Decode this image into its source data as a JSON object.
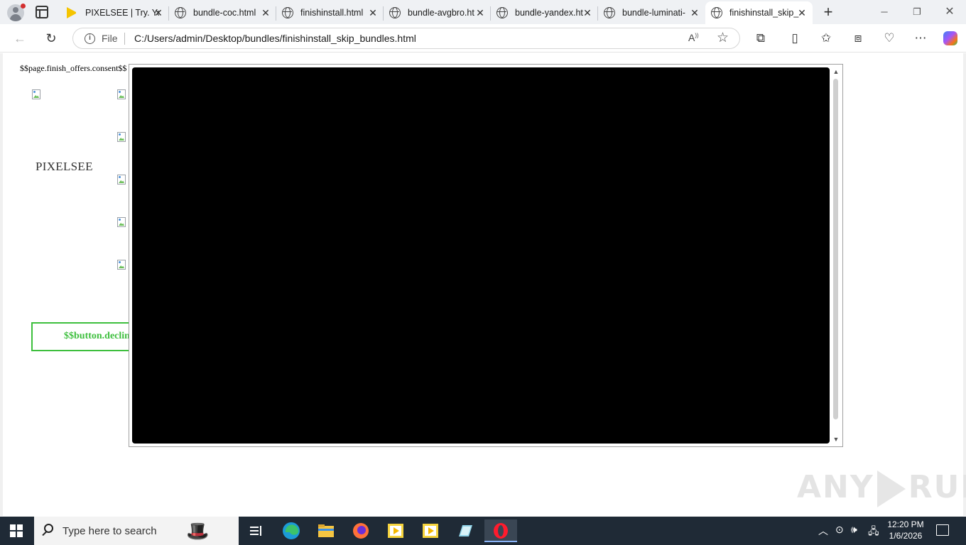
{
  "browser": {
    "tabs": [
      {
        "title": "PIXELSEE | Try. Yo",
        "favicon": "play-icon",
        "active": false
      },
      {
        "title": "bundle-coc.html",
        "favicon": "globe-icon",
        "active": false
      },
      {
        "title": "finishinstall.html",
        "favicon": "globe-icon",
        "active": false
      },
      {
        "title": "bundle-avgbro.ht",
        "favicon": "globe-icon",
        "active": false
      },
      {
        "title": "bundle-yandex.ht",
        "favicon": "globe-icon",
        "active": false
      },
      {
        "title": "bundle-luminati-",
        "favicon": "globe-icon",
        "active": false
      },
      {
        "title": "finishinstall_skip_",
        "favicon": "globe-icon",
        "active": true
      }
    ],
    "address": {
      "scheme_label": "File",
      "url": "C:/Users/admin/Desktop/bundles/finishinstall_skip_bundles.html"
    }
  },
  "page": {
    "consent_text": "$$page.finish_offers.consent$$",
    "brand_name": "PIXELSEE",
    "decline_button_label": "$$button.decline"
  },
  "watermark": {
    "text_left": "ANY",
    "text_right": "RUN"
  },
  "taskbar": {
    "search_placeholder": "Type here to search",
    "clock_time": "12:20 PM",
    "clock_date": "1/6/2026"
  },
  "colors": {
    "decline_accent": "#3dbf3d",
    "taskbar_bg": "#1f2a36",
    "tabstrip_bg": "#eff1f4"
  }
}
